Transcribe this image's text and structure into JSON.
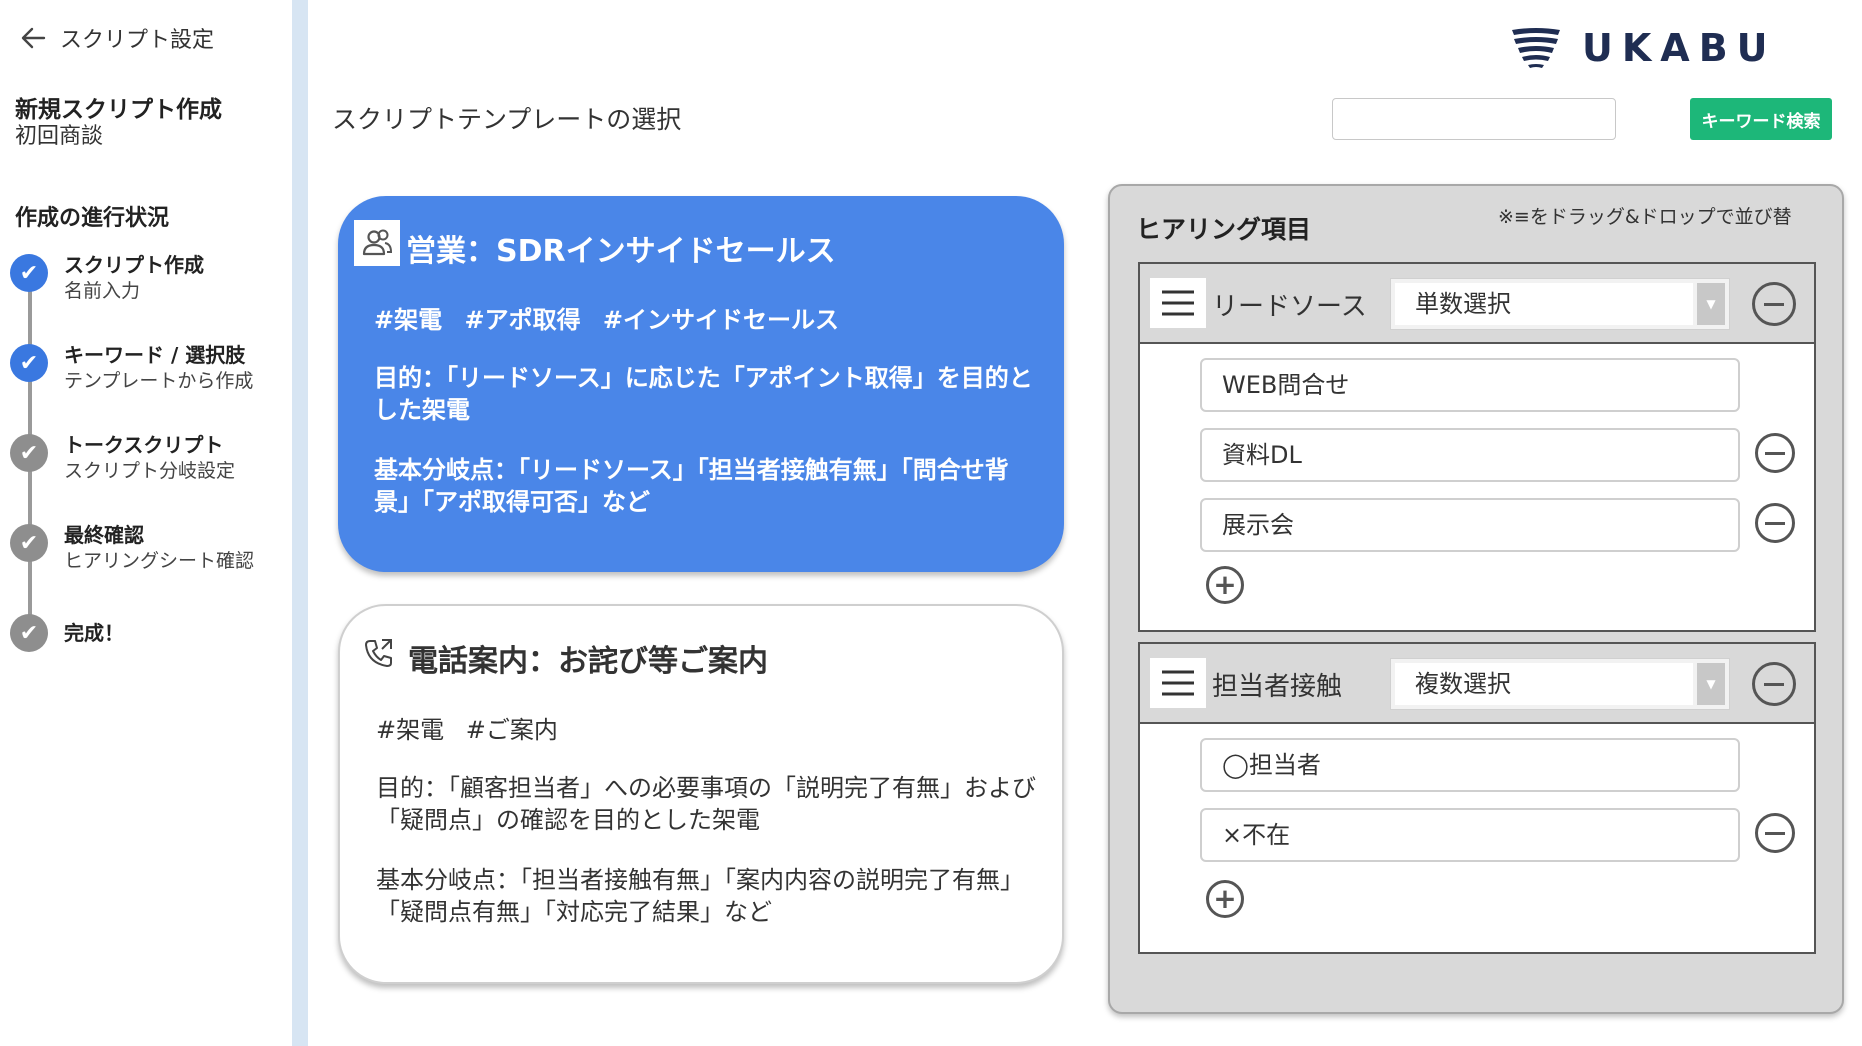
{
  "sidebar": {
    "back_label": "スクリプト設定",
    "new_script_title": "新規スクリプト作成",
    "new_script_subtitle": "初回商談",
    "progress_title": "作成の進行状況",
    "steps": [
      {
        "title": "スクリプト作成",
        "subtitle": "名前入力",
        "state": "done-current"
      },
      {
        "title": "キーワード / 選択肢",
        "subtitle": "テンプレートから作成",
        "state": "done-current"
      },
      {
        "title": "トークスクリプト",
        "subtitle": "スクリプト分岐設定",
        "state": "pending"
      },
      {
        "title": "最終確認",
        "subtitle": "ヒアリングシート確認",
        "state": "pending"
      },
      {
        "title": "完成！",
        "subtitle": "",
        "state": "pending"
      }
    ],
    "check_glyph": "✔"
  },
  "header": {
    "page_title": "スクリプトテンプレートの選択",
    "logo_text": "UKABU",
    "search_placeholder": "",
    "search_button": "キーワード検索"
  },
  "templates": [
    {
      "icon": "users-icon",
      "title": "営業：SDRインサイドセールス",
      "tags": "#架電 #アポ取得 #インサイドセールス",
      "purpose": "目的：「リードソース」に応じた「アポイント取得」を目的とした架電",
      "branches": "基本分岐点：「リードソース」「担当者接触有無」「問合せ背景」「アポ取得可否」など",
      "selected": true
    },
    {
      "icon": "phone-icon",
      "title": "電話案内：お詫び等ご案内",
      "tags": "#架電 #ご案内",
      "purpose": "目的：「顧客担当者」への必要事項の「説明完了有無」および「疑問点」の確認を目的とした架電",
      "branches": "基本分岐点：「担当者接触有無」「案内内容の説明完了有無」「疑問点有無」「対応完了結果」など",
      "selected": false
    }
  ],
  "hearing": {
    "title": "ヒアリング項目",
    "note": "※≡をドラッグ&ドロップで並び替",
    "groups": [
      {
        "label": "リードソース",
        "select_value": "単数選択",
        "options": [
          "WEB問合せ",
          "資料DL",
          "展示会"
        ]
      },
      {
        "label": "担当者接触",
        "select_value": "複数選択",
        "options": [
          "◯担当者",
          "×不在"
        ]
      }
    ]
  },
  "colors": {
    "accent_blue": "#4a86e8",
    "step_blue": "#3a78e0",
    "search_green": "#1db779",
    "sidebar_border": "#d7e5f3",
    "logo_navy": "#1f2d52"
  }
}
